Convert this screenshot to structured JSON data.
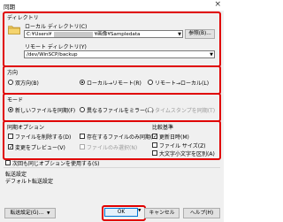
{
  "window": {
    "title": "同期",
    "close": "×"
  },
  "directory": {
    "legend": "ディレクトリ",
    "local_label": "ローカル ディレクトリ(C)",
    "local_value": "C:¥Users¥",
    "local_value_tail": "¥画像¥Sampledata",
    "browse": "参照(B)...",
    "remote_label": "リモート ディレクトリ(Y)",
    "remote_value": "/dev/WinSCP/backup"
  },
  "direction": {
    "legend": "方向",
    "options": [
      "双方向(B)",
      "ローカル→リモート(R)",
      "リモート→ローカル(L)"
    ]
  },
  "mode": {
    "legend": "モード",
    "options": [
      "新しいファイルを同期(F)",
      "異なるファイルをミラー(M)",
      "タイムスタンプを同期(T)"
    ]
  },
  "sync_options": {
    "legend": "同期オプション",
    "items": [
      "ファイルを削除する(D)",
      "存在するファイルのみ同期(E)",
      "変更をプレビュー(V)",
      "ファイルのみ選択(N)"
    ]
  },
  "compare": {
    "legend": "比較基準",
    "items": [
      "更新日時(M)",
      "ファイル サイズ(Z)",
      "大文字小文字を区別(A)"
    ]
  },
  "footer": {
    "use_same": "次回も同じオプションを使用する(S)",
    "transfer_settings": "転送設定",
    "default_transfer": "デフォルト転送設定",
    "transfer_btn": "転送設定(G)...",
    "ok": "OK",
    "cancel": "キャンセル",
    "help": "ヘルプ(H)"
  },
  "colors": {
    "highlight": "#e00000",
    "accent": "#0078d7"
  }
}
